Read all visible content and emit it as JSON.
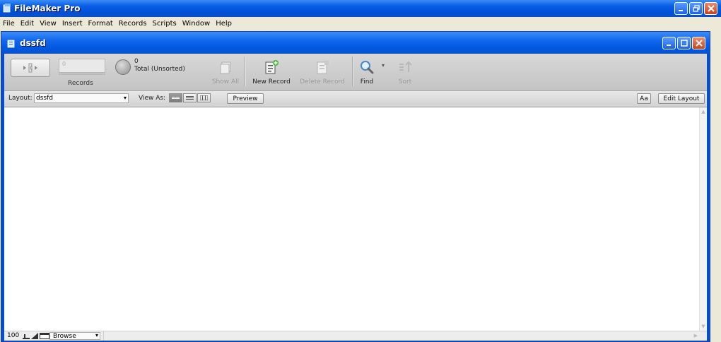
{
  "app": {
    "title": "FileMaker Pro"
  },
  "menu": [
    "File",
    "Edit",
    "View",
    "Insert",
    "Format",
    "Records",
    "Scripts",
    "Window",
    "Help"
  ],
  "document": {
    "title": "dssfd"
  },
  "toolbar": {
    "record_input_value": "0",
    "records_label": "Records",
    "found_count": "0",
    "status": "Total (Unsorted)",
    "show_all": "Show All",
    "new_record": "New Record",
    "delete_record": "Delete Record",
    "find": "Find",
    "sort": "Sort"
  },
  "layoutbar": {
    "layout_label": "Layout:",
    "layout_value": "dssfd",
    "view_as_label": "View As:",
    "preview": "Preview",
    "text_format": "Aa",
    "edit_layout": "Edit Layout"
  },
  "statusbar": {
    "zoom": "100",
    "mode": "Browse"
  },
  "colors": {
    "titlebar": "#0058e0",
    "toolbar_bg": "#cfcfcf",
    "close_button": "#c7461f"
  }
}
